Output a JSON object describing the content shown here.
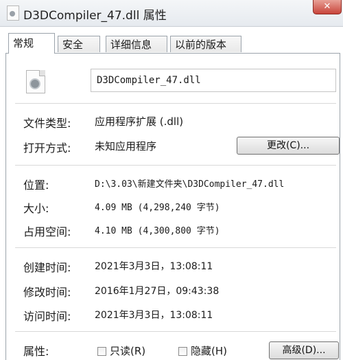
{
  "window": {
    "title": "D3DCompiler_47.dll 属性",
    "close_glyph": "✕"
  },
  "tabs": [
    {
      "label": "常规",
      "active": true
    },
    {
      "label": "安全",
      "active": false
    },
    {
      "label": "详细信息",
      "active": false
    },
    {
      "label": "以前的版本",
      "active": false
    }
  ],
  "general": {
    "file_icon": "dll-file-icon",
    "file_name": "D3DCompiler_47.dll",
    "file_type": {
      "label": "文件类型:",
      "value": "应用程序扩展 (.dll)"
    },
    "opens_with": {
      "label": "打开方式:",
      "value": "未知应用程序",
      "change_button": "更改(C)..."
    },
    "location": {
      "label": "位置:",
      "value": "D:\\3.03\\新建文件夹\\D3DCompiler_47.dll"
    },
    "size": {
      "label": "大小:",
      "value": "4.09 MB (4,298,240 字节)"
    },
    "size_on_disk": {
      "label": "占用空间:",
      "value": "4.10 MB (4,300,800 字节)"
    },
    "created": {
      "label": "创建时间:",
      "value": "2021年3月3日，13:08:11"
    },
    "modified": {
      "label": "修改时间:",
      "value": "2016年1月27日，09:43:38"
    },
    "accessed": {
      "label": "访问时间:",
      "value": "2021年3月3日，13:08:11"
    },
    "attributes": {
      "label": "属性:",
      "readonly_label": "只读(R)",
      "readonly_checked": false,
      "hidden_label": "隐藏(H)",
      "hidden_checked": false,
      "advanced_button": "高级(D)..."
    }
  },
  "colors": {
    "close_button": "#c8453b",
    "panel_border": "#9ba3ab"
  }
}
